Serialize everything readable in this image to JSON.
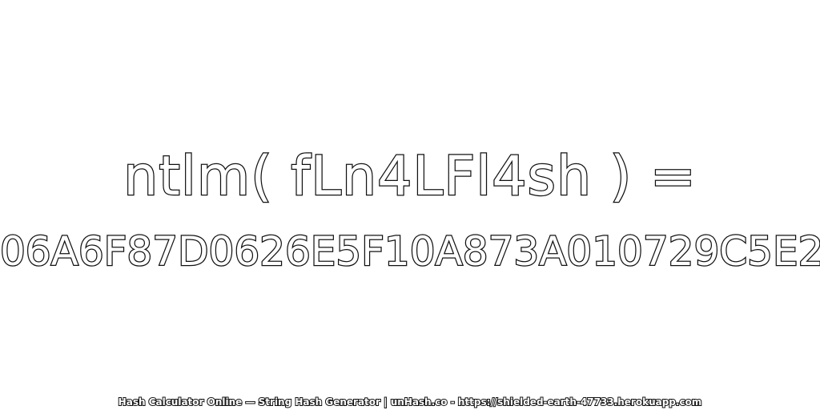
{
  "expression": {
    "text": "ntlm( fLn4LFl4sh ) ="
  },
  "hash": {
    "value": "06A6F87D0626E5F10A873A010729C5E2"
  },
  "footer": {
    "text": "Hash Calculator Online — String Hash Generator | unHash.co - https://shielded-earth-47733.herokuapp.com"
  },
  "colors": {
    "background": "#ffffff",
    "outline": "#111111",
    "fill": "#ffffff"
  }
}
